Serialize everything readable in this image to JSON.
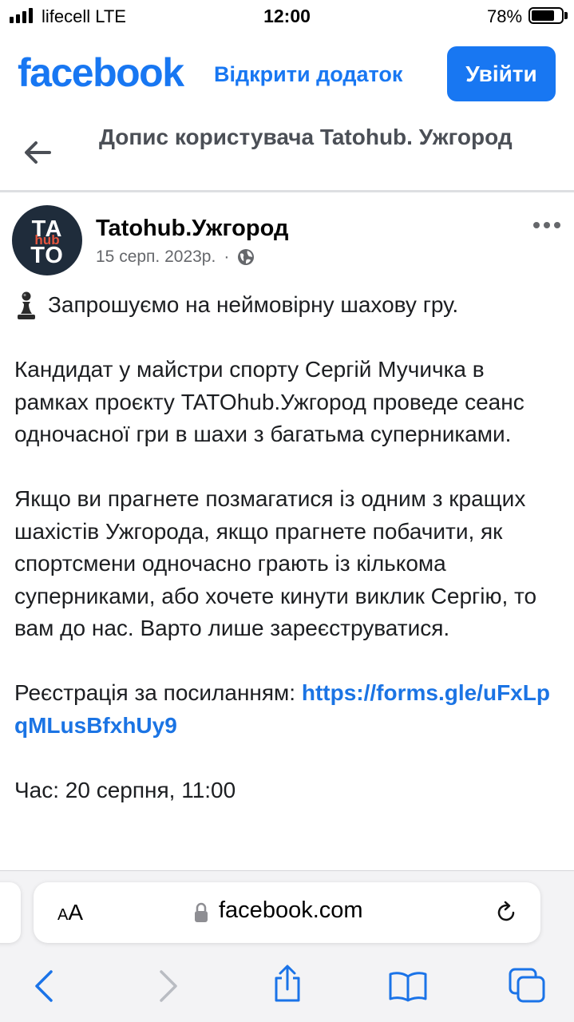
{
  "status_bar": {
    "carrier": "lifecell  LTE",
    "time": "12:00",
    "battery_percent": "78%",
    "battery_level": 0.78
  },
  "header": {
    "logo": "facebook",
    "open_app": "Відкрити додаток",
    "login": "Увійти",
    "page_title": "Допис користувача Tatohub. Ужгород"
  },
  "post": {
    "author": "Tatohub.Ужгород",
    "date": "15 серп. 2023р.",
    "separator": "·",
    "avatar": {
      "top": "ТА",
      "middle": "hub",
      "bottom": "ТО"
    },
    "paragraphs": {
      "intro": "Запрошуємо на неймовірну шахову гру.",
      "p2": "Кандидат у майстри спорту Сергій Мучичка в рамках проєкту TATOhub.Ужгород проведе сеанс одночасної гри в шахи з багатьма суперниками.",
      "p3": "Якщо ви прагнете позмагатися із одним з кращих шахістів Ужгорода, якщо прагнете побачити, як спортсмени одночасно грають із кількома суперниками, або хочете кинути виклик Сергію, то вам до нас. Варто лише зареєструватися.",
      "reg_label": "Реєстрація за посиланням: ",
      "reg_link": "https://forms.gle/uFxLpqMLusBfxhUy9",
      "time": "Час: 20 серпня, 11:00"
    }
  },
  "browser": {
    "aa_small": "A",
    "aa_large": "A",
    "url": "facebook.com"
  },
  "icons": {
    "back": "arrow-left-icon",
    "more": "more-dots-icon",
    "privacy": "globe-icon",
    "pawn": "chess-pawn-icon",
    "lock": "lock-icon",
    "reload": "reload-icon",
    "nav_back": "chevron-left-icon",
    "nav_forward": "chevron-right-icon",
    "share": "share-icon",
    "bookmarks": "book-icon",
    "tabs": "tabs-icon"
  },
  "colors": {
    "brand": "#1877f2",
    "link": "#1b74e4",
    "nav_active": "#1a73e8",
    "nav_disabled": "#b9bcc2"
  }
}
